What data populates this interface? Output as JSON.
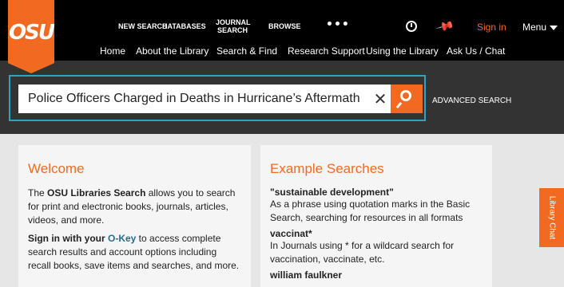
{
  "logo": {
    "text": "OSU"
  },
  "nav_top": {
    "new_search": "NEW SEARCH",
    "databases": "DATABASES",
    "journal_search_line1": "JOURNAL",
    "journal_search_line2": "SEARCH",
    "browse": "BROWSE",
    "more": "•••",
    "sign_in": "Sign in",
    "menu": "Menu"
  },
  "nav_secondary": {
    "items": [
      "Home",
      "About the Library",
      "Search & Find",
      "Research Support",
      "Using the Library",
      "Ask Us / Chat"
    ]
  },
  "search": {
    "query": "Police Officers Charged in Deaths in Hurricane’s Aftermath",
    "clear_glyph": "✕",
    "advanced": "ADVANCED SEARCH"
  },
  "welcome": {
    "title": "Welcome",
    "p1_prefix": "The ",
    "p1_bold": "OSU Libraries Search",
    "p1_rest": " allows you to search for print and electronic books, journals, articles, videos, and more.",
    "p2_bold": "Sign in with your ",
    "p2_link": "O-Key",
    "p2_rest": " to access complete search results and account options including recall books, save items and searches, and more."
  },
  "examples": {
    "title": "Example Searches",
    "items": [
      {
        "term": "\"sustainable development\"",
        "desc": "As a phrase using quotation marks in the Basic Search, searching for resources in all formats"
      },
      {
        "term": "vaccinat*",
        "desc": "In Journals using * for a wildcard search for vaccination, vaccinate, etc."
      },
      {
        "term": "william faulkner",
        "desc": ""
      }
    ]
  },
  "library_chat": "Library Chat",
  "colors": {
    "accent": "#f26a21",
    "search_border": "#2fa4c1",
    "link": "#2b6a8f"
  }
}
